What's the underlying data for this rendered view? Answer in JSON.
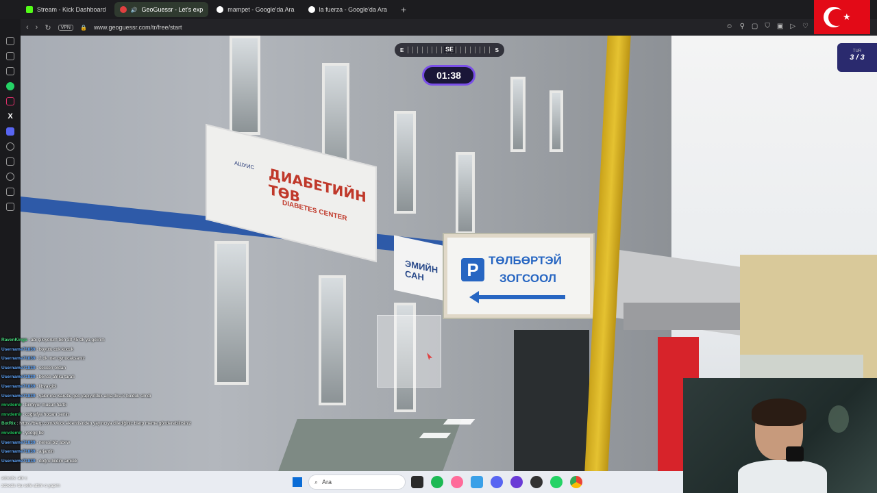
{
  "browser": {
    "tabs": [
      {
        "label": "Stream - Kick Dashboard",
        "active": false,
        "icon": "kick-icon"
      },
      {
        "label": "GeoGuessr - Let's exp",
        "active": true,
        "icon": "geoguessr-icon"
      },
      {
        "label": "mampet - Google'da Ara",
        "active": false,
        "icon": "google-icon"
      },
      {
        "label": "la fuerza - Google'da Ara",
        "active": false,
        "icon": "google-icon"
      }
    ],
    "new_tab": "+",
    "vpn_label": "VPN",
    "url": "www.geoguessr.com/tr/free/start"
  },
  "game": {
    "compass_left": "E",
    "compass_center": "SE",
    "compass_right": "S",
    "timer": "01:38",
    "round_label": "TUR",
    "round_value": "3 / 3"
  },
  "scene": {
    "sign_main": "ДИАБЕТИЙН ТӨВ",
    "sign_main_sub": "DIABETES CENTER",
    "sign_logo": "АШУИС",
    "sign_partial": "ЭМИЙН САН",
    "parking_letter": "P",
    "parking_line1": "ТӨЛБӨРТЭЙ",
    "parking_line2": "ЗОГСООЛ"
  },
  "chat": [
    {
      "user": "RavenKings",
      "msg": "abi çıkıyorum ben 30 45 dk ya gelirim",
      "color": "r"
    },
    {
      "user": "Username71839",
      "msg": "boyutu cok kucuk",
      "color": "p"
    },
    {
      "user": "Username71839",
      "msg": "2 dk ıner oynucaksanız",
      "color": "p"
    },
    {
      "user": "Username71839",
      "msg": "seccen ordan",
      "color": "p"
    },
    {
      "user": "Username71839",
      "msg": "bence afrika tarafı",
      "color": "p"
    },
    {
      "user": "Username71839",
      "msg": "libya gibi",
      "color": "p"
    },
    {
      "user": "Username71839",
      "msg": "yakınına isaretle gec yapıyofduk ama dire-k bulduk simdi",
      "color": "p"
    },
    {
      "user": "mrvdemir",
      "msg": "bilmiyor musun harbi",
      "color": "g"
    },
    {
      "user": "mrvdemir",
      "msg": "coğrafya hocanı senin",
      "color": "g"
    },
    {
      "user": "BotRix",
      "msg": "https://blerp.com/x/kick eklentisinden yayıncıya dilediğiniz blerp meme gönderebilirsiniz",
      "color": "r"
    },
    {
      "user": "mrvdemir",
      "msg": "yoogg be",
      "color": "g"
    },
    {
      "user": "Username71839",
      "msg": "neresi biz abew",
      "color": "p"
    },
    {
      "user": "Username71839",
      "msg": "arjantin",
      "color": "p"
    },
    {
      "user": "Username71839",
      "msg": "doğru bildim amkkk",
      "color": "p"
    }
  ],
  "taskbar": {
    "search_placeholder": "Ara",
    "bottom_lines": [
      "zdxcds: abi c",
      "zdxcds: bu sefe attim o yapim"
    ]
  },
  "colors": {
    "accent": "#7a4fe8",
    "timer_bg": "#1a1638",
    "round_bg": "#2a2a6e",
    "flag_red": "#e30a17",
    "parking_blue": "#2766c2"
  }
}
